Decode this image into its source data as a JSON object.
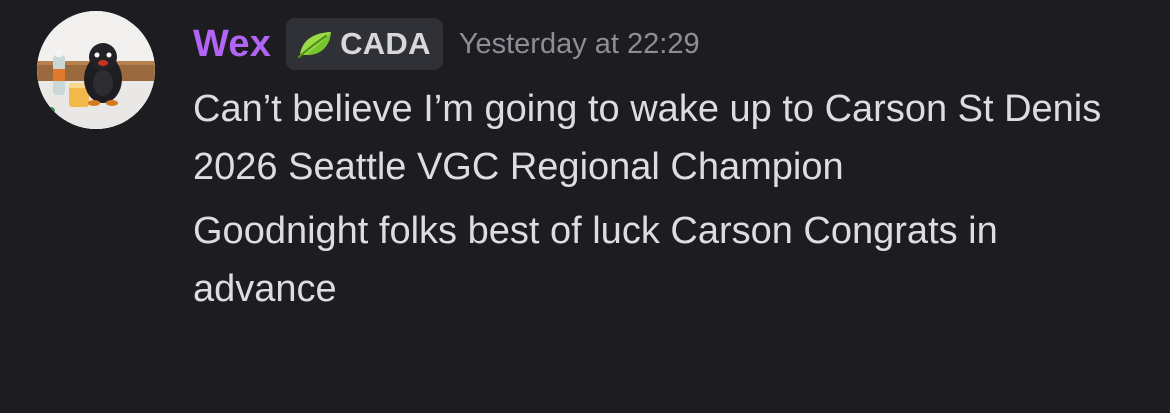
{
  "message": {
    "author": {
      "name": "Wex",
      "name_color": "#b264f4",
      "avatar_icon": "avatar-penguin-plush-photo"
    },
    "tag": {
      "icon": "leaf-icon",
      "label": "CADA"
    },
    "timestamp": "Yesterday at 22:29",
    "lines": [
      "Can’t believe I’m going to wake up to Carson St Denis 2026 Seattle VGC Regional Champion",
      "Goodnight folks best of luck Carson Congrats in advance"
    ]
  },
  "colors": {
    "background": "#1c1c21",
    "text": "#dcdde1",
    "muted_text": "#8d8e96",
    "tag_background": "#303037"
  }
}
